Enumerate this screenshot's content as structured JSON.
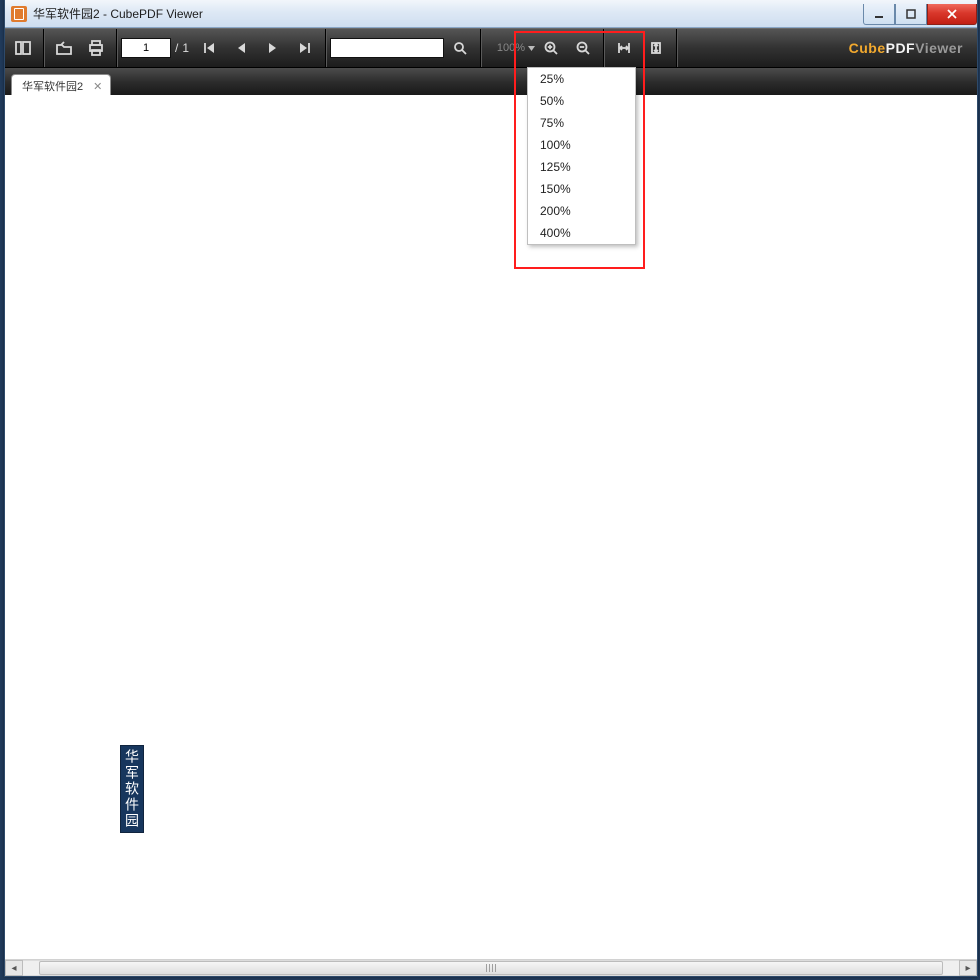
{
  "titlebar": {
    "title": "华军软件园2 - CubePDF Viewer"
  },
  "tabs": [
    {
      "label": "华军软件园2"
    }
  ],
  "page": {
    "current": "1",
    "sep": "/",
    "total": "1"
  },
  "search": {
    "value": ""
  },
  "zoom": {
    "value": "100%",
    "options": [
      "25%",
      "50%",
      "75%",
      "100%",
      "125%",
      "150%",
      "200%",
      "400%"
    ]
  },
  "logo": {
    "part1": "Cube",
    "part2": "PDF",
    "part3": "Viewer"
  },
  "document": {
    "body_text": "华军软件园"
  }
}
